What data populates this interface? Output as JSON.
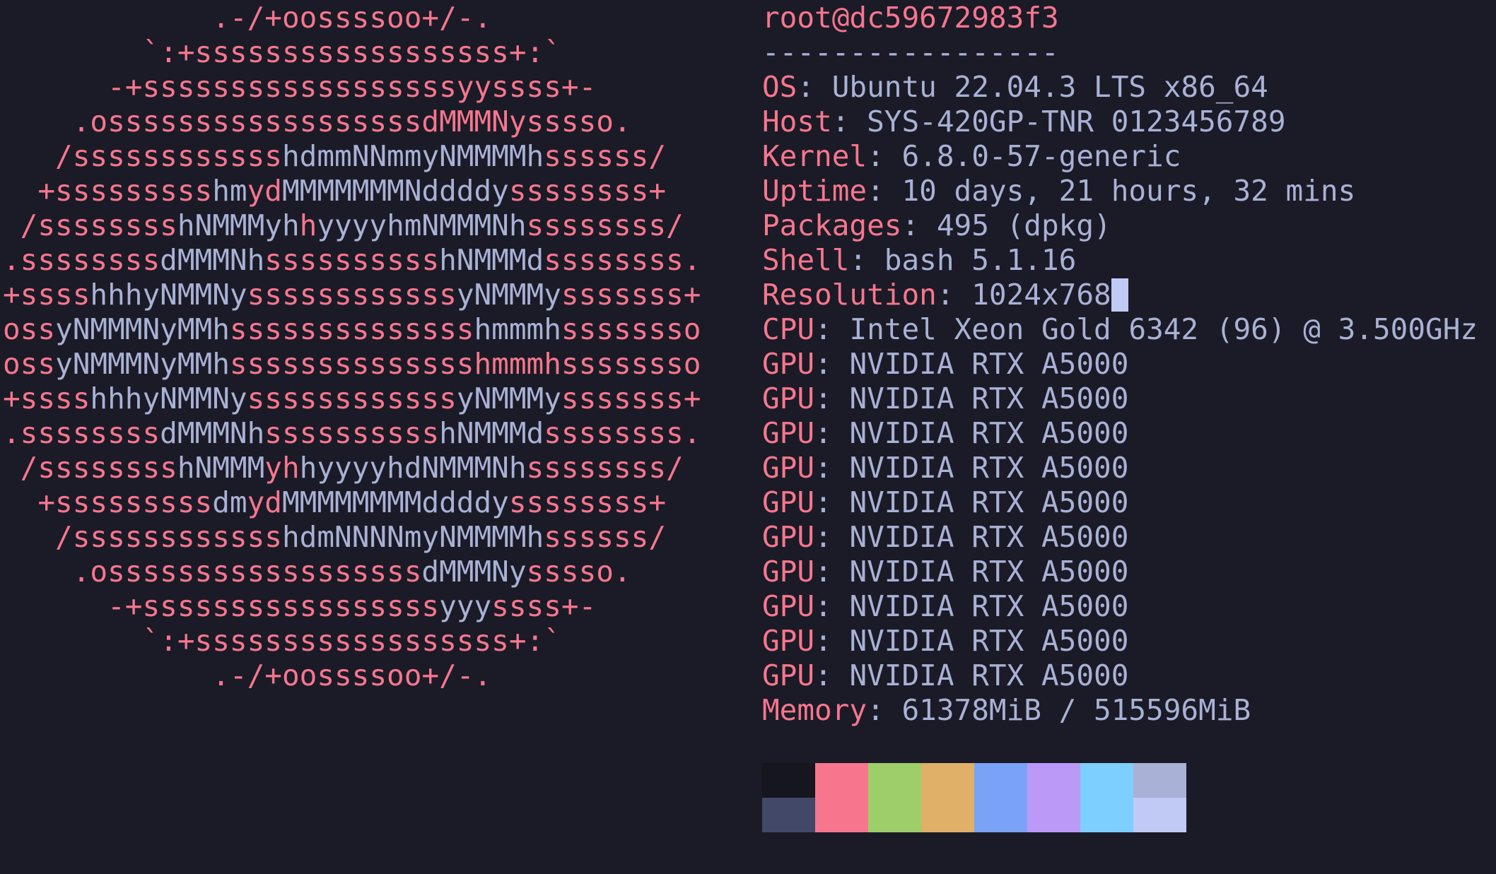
{
  "logo": {
    "lines": [
      [
        [
          "r",
          "            .-/+oossssoo+/-.            "
        ]
      ],
      [
        [
          "r",
          "        `:+ssssssssssssssssss+:`        "
        ]
      ],
      [
        [
          "r",
          "      -+ssssssssssssssssssyyssss+-      "
        ]
      ],
      [
        [
          "r",
          "    .ossssssssssssssssssdMMMNysssso.    "
        ]
      ],
      [
        [
          "r",
          "   /ssssssssssss"
        ],
        [
          "w",
          "hdmmNNmmyNMMMMh"
        ],
        [
          "r",
          "ssssss/   "
        ]
      ],
      [
        [
          "r",
          "  +sssssssss"
        ],
        [
          "w",
          "hm"
        ],
        [
          "r",
          "yd"
        ],
        [
          "w",
          "MMMMMMMNddddy"
        ],
        [
          "r",
          "ssssssss+  "
        ]
      ],
      [
        [
          "r",
          " /ssssssss"
        ],
        [
          "w",
          "hNMMMyh"
        ],
        [
          "r",
          "h"
        ],
        [
          "w",
          "yyyyhmNMMMNh"
        ],
        [
          "r",
          "ssssssss/ "
        ]
      ],
      [
        [
          "r",
          ".ssssssss"
        ],
        [
          "w",
          "dMMMNh"
        ],
        [
          "r",
          "ssssssssss"
        ],
        [
          "w",
          "hNMMMd"
        ],
        [
          "r",
          "ssssssss."
        ]
      ],
      [
        [
          "r",
          "+ssss"
        ],
        [
          "w",
          "hhhyNMMNy"
        ],
        [
          "r",
          "ssssssssssss"
        ],
        [
          "w",
          "yNMMMy"
        ],
        [
          "r",
          "sssssss+"
        ]
      ],
      [
        [
          "r",
          "oss"
        ],
        [
          "w",
          "yNMMMNyMMh"
        ],
        [
          "r",
          "ssssssssssssss"
        ],
        [
          "w",
          "hmmmh"
        ],
        [
          "r",
          "ssssssso"
        ]
      ],
      [
        [
          "r",
          "oss"
        ],
        [
          "w",
          "yNMMMNyMMh"
        ],
        [
          "r",
          "sssssssssssssshmmmhssssssso"
        ]
      ],
      [
        [
          "r",
          "+ssss"
        ],
        [
          "w",
          "hhhyNMMNy"
        ],
        [
          "r",
          "ssssssssssss"
        ],
        [
          "w",
          "yNMMMy"
        ],
        [
          "r",
          "sssssss+"
        ]
      ],
      [
        [
          "r",
          ".ssssssss"
        ],
        [
          "w",
          "dMMMNh"
        ],
        [
          "r",
          "ssssssssss"
        ],
        [
          "w",
          "hNMMMd"
        ],
        [
          "r",
          "ssssssss."
        ]
      ],
      [
        [
          "r",
          " /ssssssss"
        ],
        [
          "w",
          "hNMMM"
        ],
        [
          "r",
          "yh"
        ],
        [
          "w",
          "hyyyyhdNMMMNh"
        ],
        [
          "r",
          "ssssssss/ "
        ]
      ],
      [
        [
          "r",
          "  +sssssssss"
        ],
        [
          "w",
          "dm"
        ],
        [
          "r",
          "yd"
        ],
        [
          "w",
          "MMMMMMMMddddy"
        ],
        [
          "r",
          "ssssssss+  "
        ]
      ],
      [
        [
          "r",
          "   /ssssssssssss"
        ],
        [
          "w",
          "hdmNNNNmyNMMMMh"
        ],
        [
          "r",
          "ssssss/   "
        ]
      ],
      [
        [
          "r",
          "    .ossssssssssssssssss"
        ],
        [
          "w",
          "dMMMNy"
        ],
        [
          "r",
          "sssso.    "
        ]
      ],
      [
        [
          "r",
          "      -+sssssssssssssssss"
        ],
        [
          "w",
          "yyy"
        ],
        [
          "r",
          "ssss+-      "
        ]
      ],
      [
        [
          "r",
          "        `:+ssssssssssssssssss+:`        "
        ]
      ],
      [
        [
          "r",
          "            .-/+oossssoo+/-.            "
        ]
      ]
    ]
  },
  "info": {
    "user_host": "root@dc59672983f3",
    "dashes": "-----------------",
    "fields": [
      {
        "key": "OS",
        "value": "Ubuntu 22.04.3 LTS x86_64"
      },
      {
        "key": "Host",
        "value": "SYS-420GP-TNR 0123456789"
      },
      {
        "key": "Kernel",
        "value": "6.8.0-57-generic"
      },
      {
        "key": "Uptime",
        "value": "10 days, 21 hours, 32 mins"
      },
      {
        "key": "Packages",
        "value": "495 (dpkg)"
      },
      {
        "key": "Shell",
        "value": "bash 5.1.16"
      },
      {
        "key": "Resolution",
        "value": "1024x768",
        "cursor": true
      },
      {
        "key": "CPU",
        "value": "Intel Xeon Gold 6342 (96) @ 3.500GHz"
      },
      {
        "key": "GPU",
        "value": "NVIDIA RTX A5000"
      },
      {
        "key": "GPU",
        "value": "NVIDIA RTX A5000"
      },
      {
        "key": "GPU",
        "value": "NVIDIA RTX A5000"
      },
      {
        "key": "GPU",
        "value": "NVIDIA RTX A5000"
      },
      {
        "key": "GPU",
        "value": "NVIDIA RTX A5000"
      },
      {
        "key": "GPU",
        "value": "NVIDIA RTX A5000"
      },
      {
        "key": "GPU",
        "value": "NVIDIA RTX A5000"
      },
      {
        "key": "GPU",
        "value": "NVIDIA RTX A5000"
      },
      {
        "key": "GPU",
        "value": "NVIDIA RTX A5000"
      },
      {
        "key": "GPU",
        "value": "NVIDIA RTX A5000"
      },
      {
        "key": "Memory",
        "value": "61378MiB / 515596MiB"
      }
    ]
  },
  "colors": {
    "background": "#1a1b26",
    "accent": "#f7768e",
    "text": "#a9b1d6",
    "cursor": "#c0caf5"
  },
  "palette": {
    "top": [
      "#15161e",
      "#f7768e",
      "#9ece6a",
      "#e0af68",
      "#7aa2f7",
      "#bb9af7",
      "#7dcfff",
      "#a9b1d6"
    ],
    "bottom": [
      "#414868",
      "#f7768e",
      "#9ece6a",
      "#e0af68",
      "#7aa2f7",
      "#bb9af7",
      "#7dcfff",
      "#c0caf5"
    ]
  }
}
